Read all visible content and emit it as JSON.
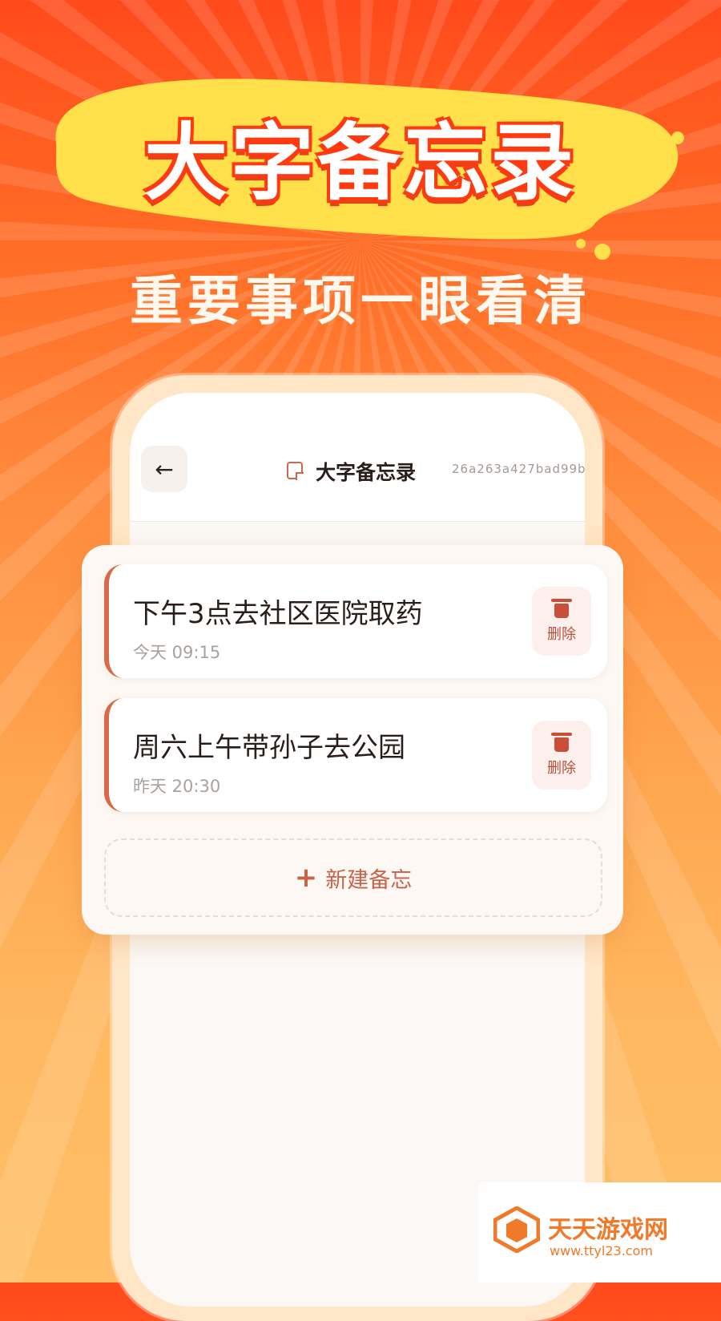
{
  "promo": {
    "headline": "大字备忘录",
    "subheadline": "重要事项一眼看清",
    "banner_color": "#ffe04a",
    "accent_color": "#ff3a10"
  },
  "header": {
    "back_icon": "back-arrow-icon",
    "title_icon": "note-icon",
    "title": "大字备忘录",
    "id_text": "26a263a427bad99b"
  },
  "memos": [
    {
      "text": "下午3点去社区医院取药",
      "time": "今天 09:15",
      "delete_label": "删除"
    },
    {
      "text": "周六上午带孙子去公园",
      "time": "昨天 20:30",
      "delete_label": "删除"
    }
  ],
  "new_button": {
    "icon": "plus-icon",
    "label": "新建备忘"
  },
  "watermark": {
    "name": "天天游戏网",
    "url": "www.ttyl23.com"
  },
  "colors": {
    "accent": "#d66a4a",
    "delete_bg": "#fdf0ec",
    "background_top": "#ff4a1c",
    "background_bottom": "#ffbf66"
  }
}
